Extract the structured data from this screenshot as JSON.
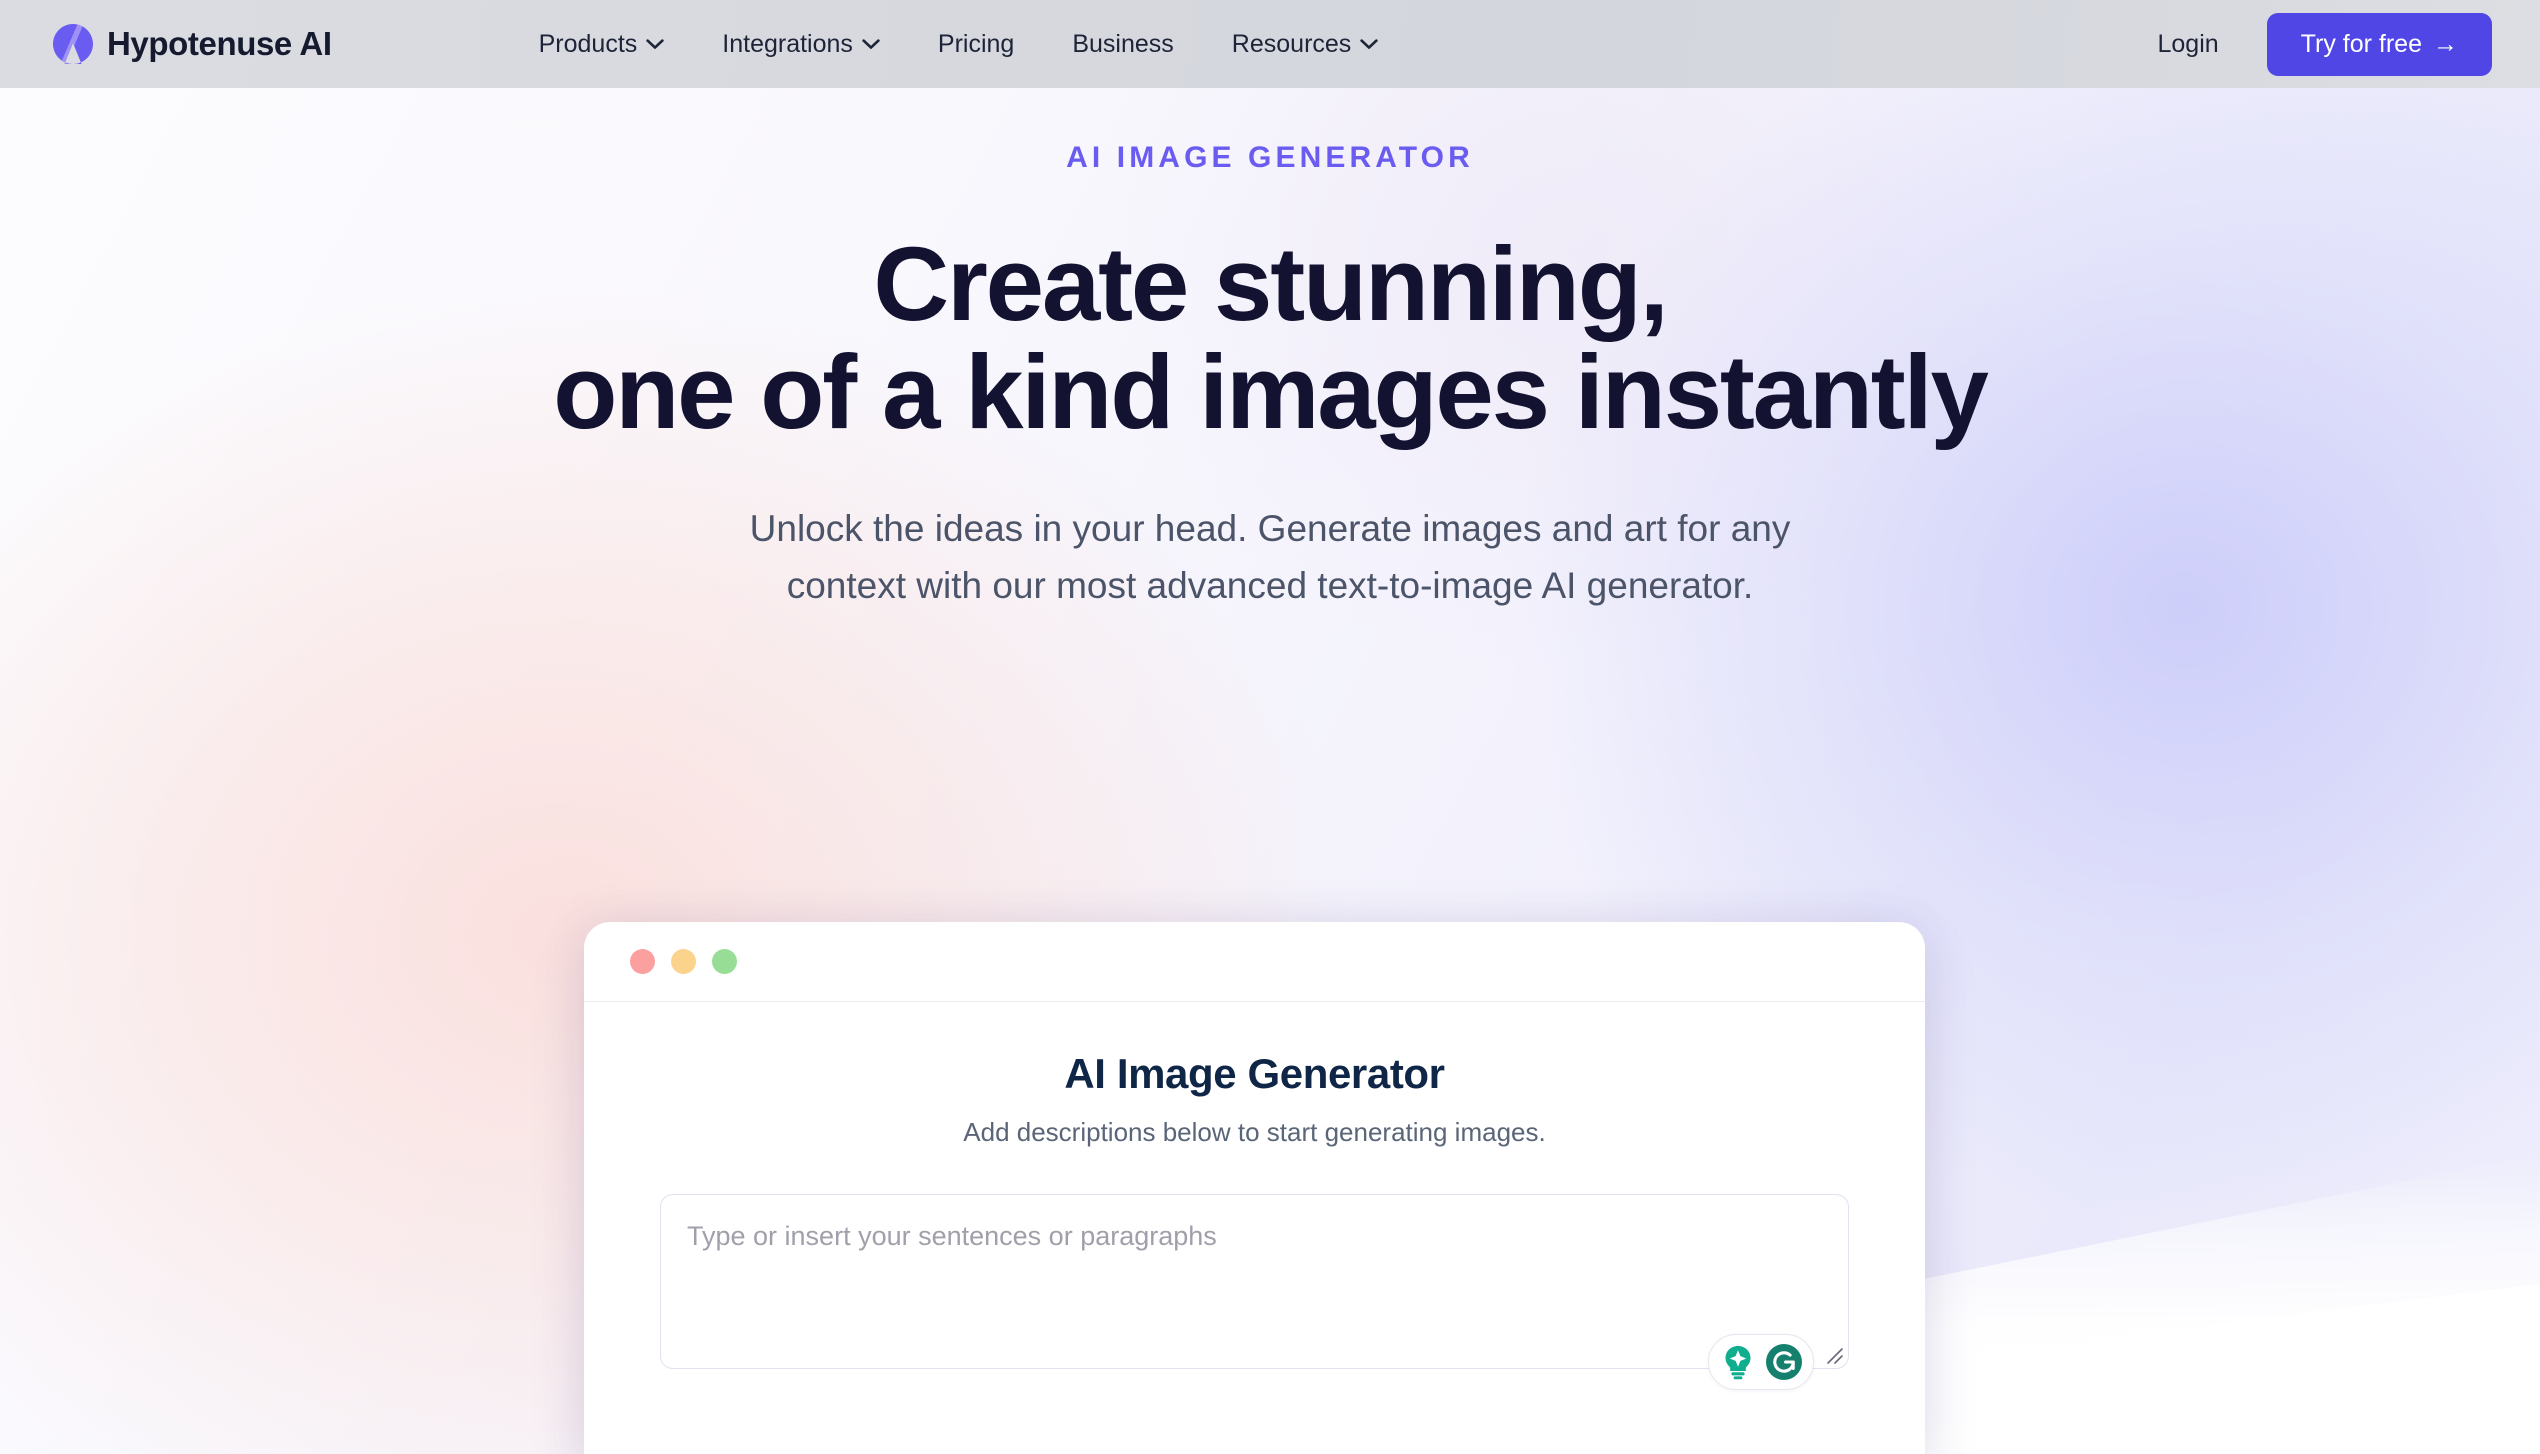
{
  "navbar": {
    "brand": {
      "name": "Hypotenuse AI",
      "logo_icon": "hypotenuse-logo-icon",
      "accent_color": "#6a5cf0"
    },
    "links": [
      {
        "label": "Products",
        "has_dropdown": true,
        "icon": "chevron-down-icon"
      },
      {
        "label": "Integrations",
        "has_dropdown": true,
        "icon": "chevron-down-icon"
      },
      {
        "label": "Pricing",
        "has_dropdown": false
      },
      {
        "label": "Business",
        "has_dropdown": false
      },
      {
        "label": "Resources",
        "has_dropdown": true,
        "icon": "chevron-down-icon"
      }
    ],
    "login_label": "Login",
    "cta_label": "Try for free",
    "cta_arrow": "→",
    "cta_color": "#4f46e5"
  },
  "hero": {
    "eyebrow": "AI IMAGE GENERATOR",
    "headline_line1": "Create stunning,",
    "headline_line2": "one of a kind images instantly",
    "subhead_line1": "Unlock the ideas in your head. Generate images and art for any",
    "subhead_line2": "context with our most advanced text-to-image AI generator.",
    "eyebrow_color": "#6a5cf0",
    "headline_color": "#131331",
    "subhead_color": "#4b5469"
  },
  "mockup": {
    "window_dots": [
      {
        "name": "close-dot",
        "color": "#fc9f9f"
      },
      {
        "name": "minimize-dot",
        "color": "#fcd38d"
      },
      {
        "name": "maximize-dot",
        "color": "#97dd96"
      }
    ],
    "title": "AI Image Generator",
    "subtitle": "Add descriptions below to start generating images.",
    "prompt_placeholder": "Type or insert your sentences or paragraphs",
    "prompt_value": "",
    "assistant_icons": [
      {
        "name": "grammarly-lightbulb-icon",
        "color": "#0fae8e"
      },
      {
        "name": "grammarly-logo-icon",
        "color": "#15806d"
      }
    ]
  }
}
